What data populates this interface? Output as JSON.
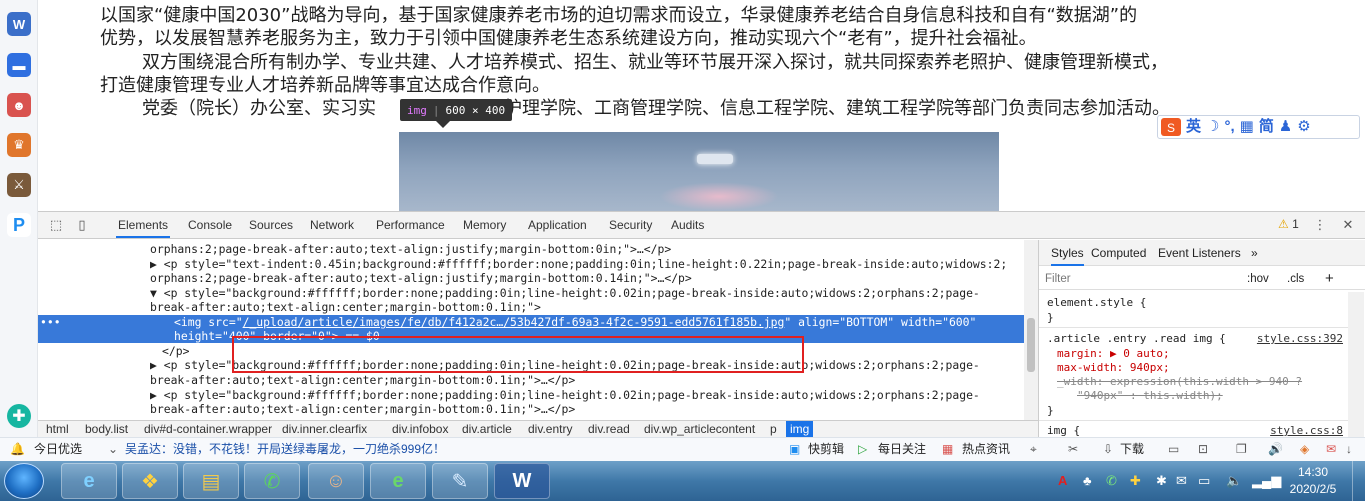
{
  "article": {
    "para1": "以国家“健康中国2030”战略为导向，基于国家健康养老市场的迫切需求而设立，华录健康养老结合自身信息科技和自有“数据湖”的",
    "para2": "优势，以发展智慧养老服务为主，致力于引领中国健康养老生态系统建设方向，推动实现六个“老有”，提升社会福祉。",
    "para3": "双方围绕混合所有制办学、专业共建、人才培养模式、招生、就业等环节展开深入探讨，就共同探索养老照护、健康管理新模式，",
    "para4": "打造健康管理专业人才培养新品牌等事宜达成合作意向。",
    "para5a": "党委（院长）办公室、实习实",
    "para5b": "护理学院、工商管理学院、信息工程学院、建筑工程学院等部门负责同志参加活动。"
  },
  "tooltip": {
    "tag": "img",
    "size": "600 × 400"
  },
  "ime": {
    "lang": "英",
    "simplified": "简"
  },
  "devtools": {
    "tabs": [
      "Elements",
      "Console",
      "Sources",
      "Network",
      "Performance",
      "Memory",
      "Application",
      "Security",
      "Audits"
    ],
    "active_tab": "Elements",
    "warning_count": "1",
    "dom_lines": [
      "orphans:2;page-break-after:auto;text-align:justify;margin-bottom:0in;\">…</p>",
      "▶ <p style=\"text-indent:0.45in;background:#ffffff;border:none;padding:0in;line-height:0.22in;page-break-inside:auto;widows:2;",
      "orphans:2;page-break-after:auto;text-align:justify;margin-bottom:0.14in;\">…</p>",
      "▼ <p style=\"background:#ffffff;border:none;padding:0in;line-height:0.02in;page-break-inside:auto;widows:2;orphans:2;page-",
      "break-after:auto;text-align:center;margin-bottom:0.1in;\">",
      "</p>",
      "▶ <p style=\"background:#ffffff;border:none;padding:0in;line-height:0.02in;page-break-inside:auto;widows:2;orphans:2;page-",
      "break-after:auto;text-align:center;margin-bottom:0.1in;\">…</p>",
      "▶ <p style=\"background:#ffffff;border:none;padding:0in;line-height:0.02in;page-break-inside:auto;widows:2;orphans:2;page-",
      "break-after:auto;text-align:center;margin-bottom:0.1in;\">…</p>"
    ],
    "selected": {
      "dots": "•••",
      "tag_open": "<img",
      "src_attr": "src=\"",
      "src_value": "/_upload/article/images/fe/db/f412a2c…/53b427df-69a3-4f2c-9591-edd5761f185b.jpg",
      "rest1": "\" align=\"BOTTOM\" width=\"600\"",
      "line2": "height=\"400\" border=\"0\"> == $0"
    },
    "breadcrumbs": [
      "html",
      "body.list",
      "div#d-container.wrapper",
      "div.inner.clearfix",
      "div.infobox",
      "div.article",
      "div.entry",
      "div.read",
      "div.wp_articlecontent",
      "p",
      "img"
    ],
    "active_crumb": "img",
    "styles": {
      "tabs": [
        "Styles",
        "Computed",
        "Event Listeners"
      ],
      "more": "»",
      "filter_placeholder": "Filter",
      "hov": ":hov",
      "cls": ".cls",
      "plus": "+",
      "element_style": "element.style {",
      "close_brace": "}",
      "rule_selector": ".article .entry .read img {",
      "rule_link": "style.css:392",
      "margin": "margin: ▶ 0 auto;",
      "max_width": "max-width: 940px;",
      "strike1": "_width: expression(this.width > 940 ?",
      "strike2": "\"940px\" : this.width);",
      "rule2_selector": "img {",
      "rule2_link": "style.css:8"
    }
  },
  "info_bar": {
    "today": "今日优选",
    "headline": "吴孟达：没错，不花钱！开局送绿毒屠龙，一刀绝杀999亿！",
    "kuaijian": "快剪辑",
    "meiri": "每日关注",
    "redian": "热点资讯",
    "download": "下载"
  },
  "taskbar": {
    "time": "14:30",
    "date": "2020/2/5",
    "apps": [
      "ie",
      "apps",
      "explorer",
      "wechat",
      "person",
      "browser360",
      "notepad",
      "word"
    ]
  }
}
